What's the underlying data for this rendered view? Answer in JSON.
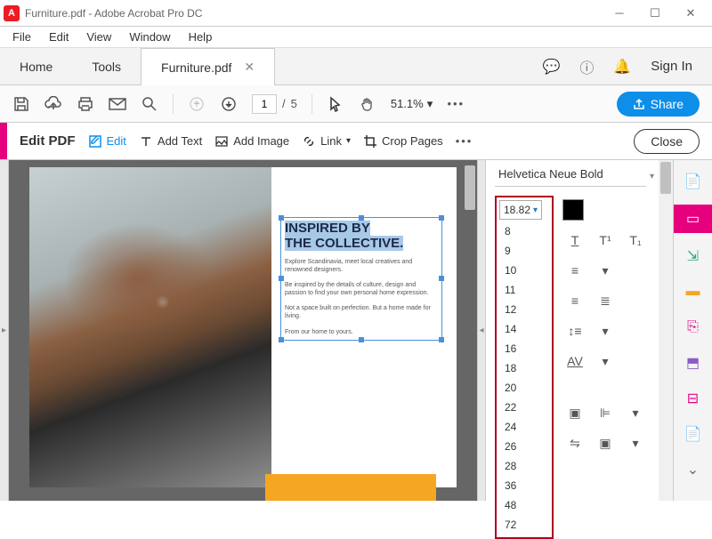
{
  "window": {
    "title": "Furniture.pdf - Adobe Acrobat Pro DC"
  },
  "menu": [
    "File",
    "Edit",
    "View",
    "Window",
    "Help"
  ],
  "tabs": {
    "home": "Home",
    "tools": "Tools",
    "doc": "Furniture.pdf"
  },
  "tabbar_right": {
    "signin": "Sign In"
  },
  "toolbar": {
    "page_current": "1",
    "page_total": "5",
    "page_sep": "/",
    "zoom": "51.1%",
    "share": "Share"
  },
  "editbar": {
    "title": "Edit PDF",
    "edit": "Edit",
    "add_text": "Add Text",
    "add_image": "Add Image",
    "link": "Link",
    "crop": "Crop Pages",
    "close": "Close"
  },
  "document": {
    "headline_l1": "INSPIRED BY",
    "headline_l2": "THE COLLECTIVE.",
    "p1": "Explore Scandinavia, meet local creatives and renowned designers.",
    "p2": "Be inspired by the details of culture, design and passion to find your own personal home expression.",
    "p3": "Not a space built on perfection. But a home made for living.",
    "p4": "From our home to yours."
  },
  "format": {
    "font": "Helvetica Neue Bold",
    "size": "18.82",
    "sizes": [
      "8",
      "9",
      "10",
      "11",
      "12",
      "14",
      "16",
      "18",
      "20",
      "22",
      "24",
      "26",
      "28",
      "36",
      "48",
      "72"
    ]
  },
  "rail_icons": [
    "create-pdf",
    "edit-pdf",
    "export-pdf",
    "comment",
    "organize",
    "combine",
    "redact",
    "optimize",
    "more"
  ]
}
